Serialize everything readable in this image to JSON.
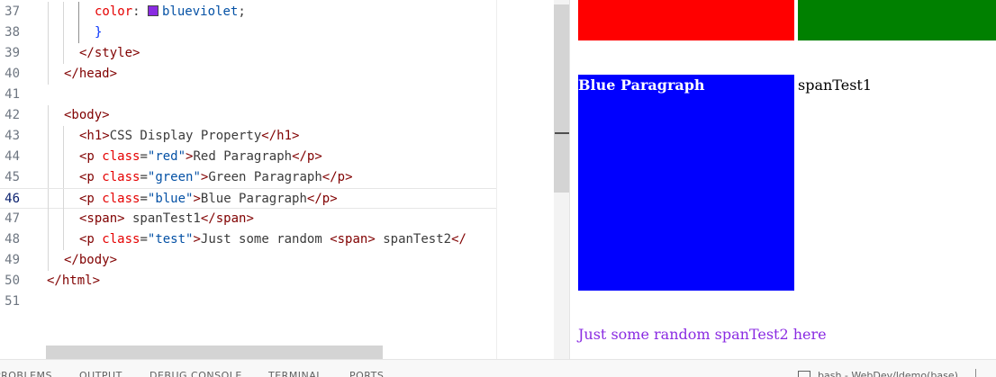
{
  "editor": {
    "lines": [
      {
        "num": "37",
        "indent": 3,
        "tokens": [
          [
            "prop",
            "color"
          ],
          [
            "plain",
            ": "
          ],
          [
            "swatch",
            ""
          ],
          [
            "str",
            "blueviolet"
          ],
          [
            "plain",
            ";"
          ]
        ]
      },
      {
        "num": "38",
        "indent": 3,
        "tokens": [
          [
            "brace",
            "}"
          ]
        ]
      },
      {
        "num": "39",
        "indent": 2,
        "tokens": [
          [
            "tag",
            "</style>"
          ]
        ]
      },
      {
        "num": "40",
        "indent": 1,
        "tokens": [
          [
            "tag",
            "</head>"
          ]
        ]
      },
      {
        "num": "41",
        "indent": 0,
        "tokens": []
      },
      {
        "num": "42",
        "indent": 1,
        "tokens": [
          [
            "tag",
            "<body>"
          ]
        ]
      },
      {
        "num": "43",
        "indent": 2,
        "tokens": [
          [
            "tag",
            "<h1>"
          ],
          [
            "plain",
            "CSS Display Property"
          ],
          [
            "tag",
            "</h1>"
          ]
        ]
      },
      {
        "num": "44",
        "indent": 2,
        "tokens": [
          [
            "tag",
            "<p "
          ],
          [
            "attr",
            "class"
          ],
          [
            "plain",
            "="
          ],
          [
            "str",
            "\"red\""
          ],
          [
            "tag",
            ">"
          ],
          [
            "plain",
            "Red Paragraph"
          ],
          [
            "tag",
            "</p>"
          ]
        ]
      },
      {
        "num": "45",
        "indent": 2,
        "tokens": [
          [
            "tag",
            "<p "
          ],
          [
            "attr",
            "class"
          ],
          [
            "plain",
            "="
          ],
          [
            "str",
            "\"green\""
          ],
          [
            "tag",
            ">"
          ],
          [
            "plain",
            "Green Paragraph"
          ],
          [
            "tag",
            "</p>"
          ]
        ]
      },
      {
        "num": "46",
        "indent": 2,
        "current": true,
        "tokens": [
          [
            "tag",
            "<p "
          ],
          [
            "attr",
            "class"
          ],
          [
            "plain",
            "="
          ],
          [
            "str",
            "\"blue\""
          ],
          [
            "tag",
            ">"
          ],
          [
            "plain",
            "Blue Paragraph"
          ],
          [
            "tag",
            "</p>"
          ]
        ]
      },
      {
        "num": "47",
        "indent": 2,
        "tokens": [
          [
            "tag",
            "<span>"
          ],
          [
            "plain",
            " spanTest1"
          ],
          [
            "tag",
            "</span>"
          ]
        ]
      },
      {
        "num": "48",
        "indent": 2,
        "tokens": [
          [
            "tag",
            "<p "
          ],
          [
            "attr",
            "class"
          ],
          [
            "plain",
            "="
          ],
          [
            "str",
            "\"test\""
          ],
          [
            "tag",
            ">"
          ],
          [
            "plain",
            "Just some random "
          ],
          [
            "tag",
            "<span>"
          ],
          [
            "plain",
            " spanTest2"
          ],
          [
            "tag",
            "</"
          ]
        ]
      },
      {
        "num": "49",
        "indent": 1,
        "tokens": [
          [
            "tag",
            "</body>"
          ]
        ]
      },
      {
        "num": "50",
        "indent": 0,
        "tokens": [
          [
            "tag",
            "</html>"
          ]
        ]
      },
      {
        "num": "51",
        "indent": 0,
        "tokens": []
      }
    ]
  },
  "preview": {
    "blue_paragraph": "Blue Paragraph",
    "span_test1": "spanTest1",
    "test_paragraph": "Just some random spanTest2 here",
    "colors": {
      "red": "#ff0000",
      "green": "#008000",
      "blue": "#0000ff",
      "blueviolet": "#8a2be2"
    }
  },
  "panel": {
    "tabs": [
      "PROBLEMS",
      "OUTPUT",
      "DEBUG CONSOLE",
      "TERMINAL",
      "PORTS"
    ],
    "terminal_label": "bash - WebDev/ldemo(base)"
  }
}
